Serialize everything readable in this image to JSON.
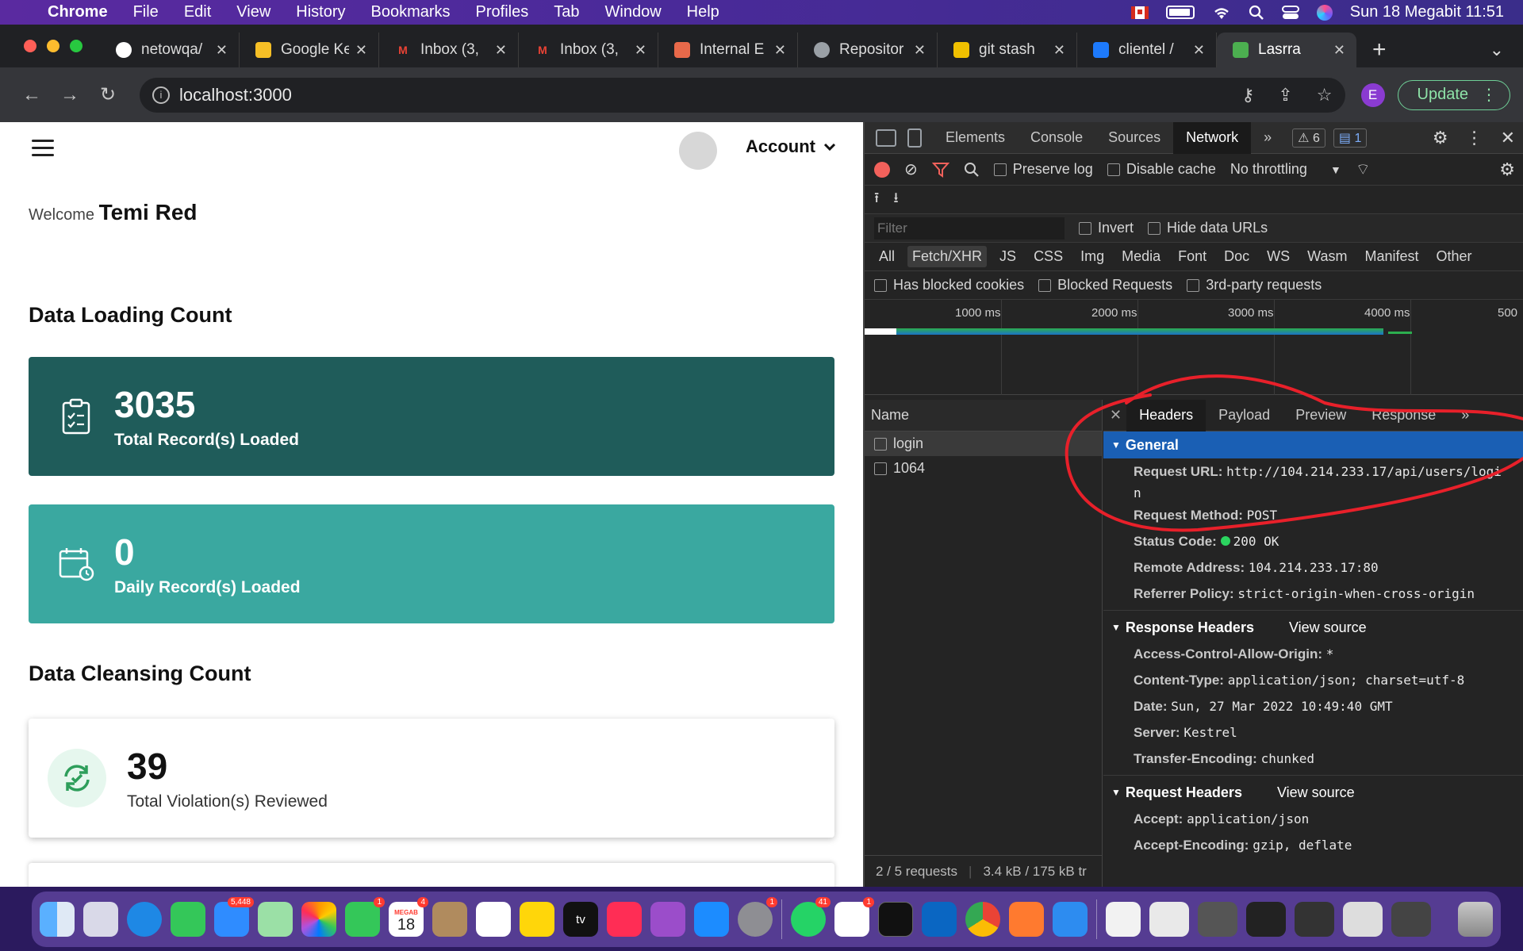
{
  "menubar": {
    "app": "Chrome",
    "items": [
      "File",
      "Edit",
      "View",
      "History",
      "Bookmarks",
      "Profiles",
      "Tab",
      "Window",
      "Help"
    ],
    "datetime": "Sun 18 Megabit  11:51"
  },
  "tabs": [
    {
      "label": "netowqa/",
      "icon": "github-icon",
      "color": "#ffffff"
    },
    {
      "label": "Google Ke",
      "icon": "keep-icon",
      "color": "#f6bf26"
    },
    {
      "label": "Inbox (3,",
      "icon": "gmail-icon",
      "color": "#ea4335"
    },
    {
      "label": "Inbox (3,",
      "icon": "gmail-icon",
      "color": "#ea4335"
    },
    {
      "label": "Internal E",
      "icon": "app-icon",
      "color": "#e8694a"
    },
    {
      "label": "Repositor",
      "icon": "globe-icon",
      "color": "#9aa0a6"
    },
    {
      "label": "git stash",
      "icon": "stack-icon",
      "color": "#f0c000"
    },
    {
      "label": "clientel /",
      "icon": "trello-icon",
      "color": "#1d7afc"
    },
    {
      "label": "Lasrra",
      "icon": "site-icon",
      "color": "#4caf50",
      "active": true
    }
  ],
  "address": {
    "url": "localhost:3000",
    "update_label": "Update",
    "profile_initial": "E"
  },
  "page": {
    "account_label": "Account",
    "welcome_prefix": "Welcome",
    "user_name": "Temi Red",
    "section_loading": "Data Loading Count",
    "section_cleansing": "Data Cleansing Count",
    "cards": [
      {
        "value": "3035",
        "label": "Total Record(s) Loaded"
      },
      {
        "value": "0",
        "label": "Daily Record(s) Loaded"
      },
      {
        "value": "39",
        "label": "Total Violation(s) Reviewed"
      }
    ]
  },
  "devtools": {
    "tabs": [
      "Elements",
      "Console",
      "Sources",
      "Network"
    ],
    "active_tab": "Network",
    "warn_count": "6",
    "msg_count": "1",
    "toolbar": {
      "preserve_log": "Preserve log",
      "disable_cache": "Disable cache",
      "throttling": "No throttling"
    },
    "filter_placeholder": "Filter",
    "invert": "Invert",
    "hide_data_urls": "Hide data URLs",
    "types": [
      "All",
      "Fetch/XHR",
      "JS",
      "CSS",
      "Img",
      "Media",
      "Font",
      "Doc",
      "WS",
      "Wasm",
      "Manifest",
      "Other"
    ],
    "selected_type": "Fetch/XHR",
    "blocked": {
      "cookies": "Has blocked cookies",
      "requests": "Blocked Requests",
      "third_party": "3rd-party requests"
    },
    "ticks": [
      "1000 ms",
      "2000 ms",
      "3000 ms",
      "4000 ms",
      "500"
    ],
    "name_header": "Name",
    "requests": [
      "login",
      "1064"
    ],
    "status": {
      "requests": "2 / 5 requests",
      "transfer": "3.4 kB / 175 kB tr"
    },
    "detail_tabs": [
      "Headers",
      "Payload",
      "Preview",
      "Response"
    ],
    "general": {
      "title": "General",
      "request_url_key": "Request URL:",
      "request_url": "http://104.214.233.17/api/users/logi",
      "request_url_wrap": "n",
      "method_key": "Request Method:",
      "method": "POST",
      "status_key": "Status Code:",
      "status": "200 OK",
      "remote_key": "Remote Address:",
      "remote": "104.214.233.17:80",
      "referrer_key": "Referrer Policy:",
      "referrer": "strict-origin-when-cross-origin"
    },
    "response_headers": {
      "title": "Response Headers",
      "view_source": "View source",
      "items": [
        {
          "k": "Access-Control-Allow-Origin:",
          "v": "*"
        },
        {
          "k": "Content-Type:",
          "v": "application/json; charset=utf-8"
        },
        {
          "k": "Date:",
          "v": "Sun, 27 Mar 2022 10:49:40 GMT"
        },
        {
          "k": "Server:",
          "v": "Kestrel"
        },
        {
          "k": "Transfer-Encoding:",
          "v": "chunked"
        }
      ]
    },
    "request_headers": {
      "title": "Request Headers",
      "view_source": "View source",
      "items": [
        {
          "k": "Accept:",
          "v": "application/json"
        },
        {
          "k": "Accept-Encoding:",
          "v": "gzip, deflate"
        }
      ]
    }
  },
  "dock": {
    "badges": {
      "mail": "5,448",
      "facetime": "1",
      "calendar_day": "18",
      "calendar_badge": "4",
      "calendar_month": "MEGAB",
      "settings": "1",
      "whatsapp": "41",
      "slack": "1"
    }
  }
}
